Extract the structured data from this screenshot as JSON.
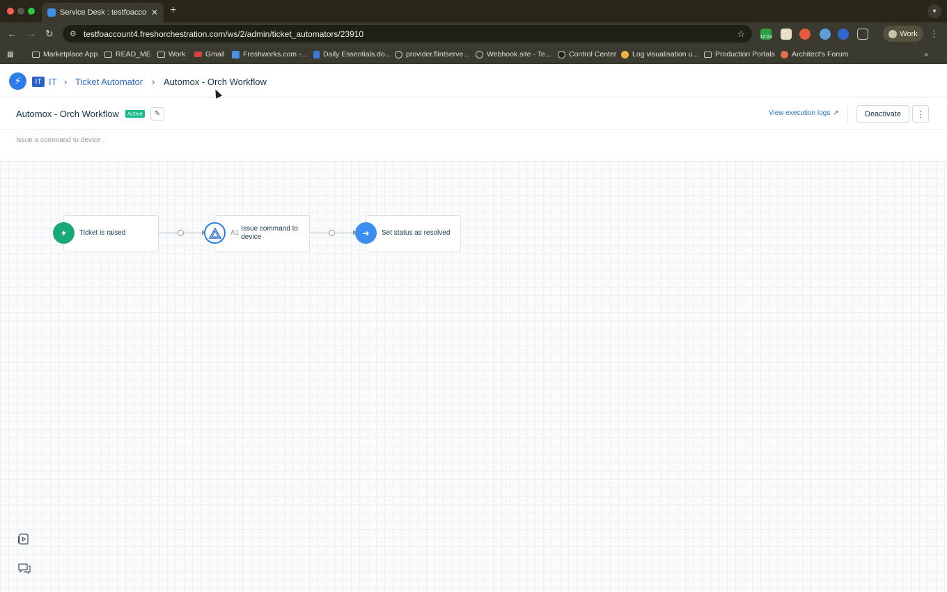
{
  "browser": {
    "tab_title": "Service Desk : testfoaccount4",
    "tab_close": "✕",
    "new_tab": "+",
    "url": "testfoaccount4.freshorchestration.com/ws/2/admin/ticket_automators/23910",
    "profile_label": "Work",
    "ext_badge": "12:13",
    "bookmarks": [
      "Marketplace App",
      "READ_ME",
      "Work",
      "Gmail",
      "Freshworks.com -...",
      "Daily Essentials.do...",
      "provider.flintserve...",
      "Webhook.site - Te...",
      "Control Center",
      "Log visualisation u...",
      "Production Portals",
      "Architect's Forum"
    ],
    "bookmarks_more": "»"
  },
  "header": {
    "workspace_badge": "IT",
    "breadcrumb": {
      "workspace": "IT",
      "section": "Ticket Automator",
      "current": "Automox - Orch Workflow"
    },
    "separator": "›"
  },
  "workflow": {
    "title": "Automox - Orch Workflow",
    "status": "Active",
    "description": "Issue a command to device .",
    "execution_logs_label": "View execution logs",
    "deactivate_label": "Deactivate"
  },
  "nodes": [
    {
      "prefix": "",
      "label": "Ticket is raised",
      "icon": "ticket-event-icon",
      "color": "#19a974"
    },
    {
      "prefix": "A1",
      "label": "Issue command to device",
      "icon": "automox-app-icon",
      "color": "#2b7de9"
    },
    {
      "prefix": "",
      "label": "Set status as resolved",
      "icon": "action-arrow-icon",
      "color": "#3c8ef0"
    }
  ],
  "colors": {
    "brand": "#2b7de9",
    "link": "#2b6cd4",
    "active_badge": "#12b886",
    "text_primary": "#12344d"
  }
}
